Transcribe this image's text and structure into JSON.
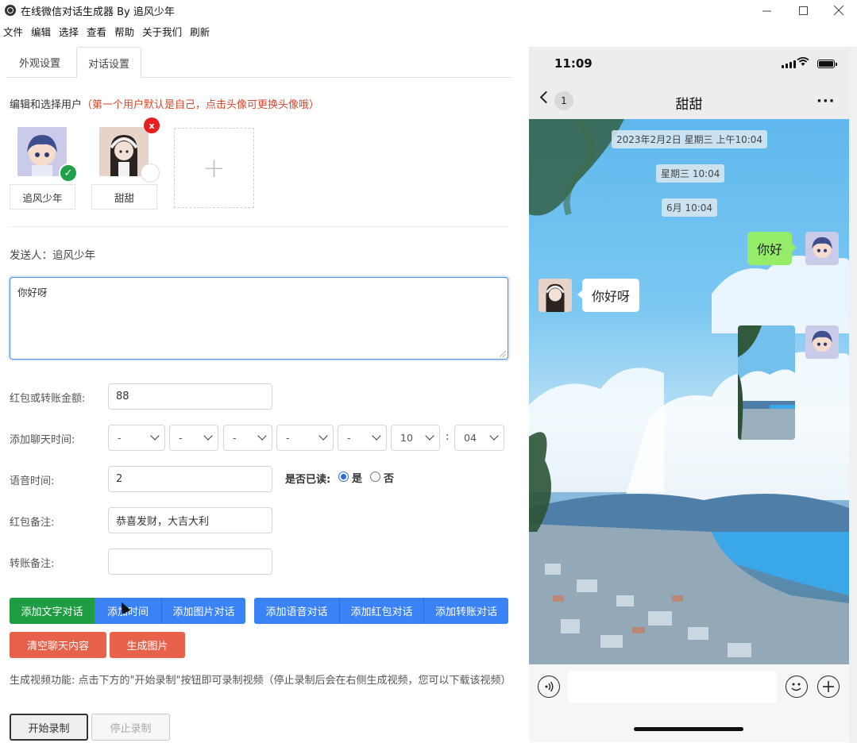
{
  "window": {
    "title": "在线微信对话生成器 By 追风少年",
    "controls": [
      "minimize-icon",
      "maximize-icon",
      "close-icon"
    ]
  },
  "menu": [
    "文件",
    "编辑",
    "选择",
    "查看",
    "帮助",
    "关于我们",
    "刷新"
  ],
  "tabs": [
    {
      "label": "外观设置",
      "active": false
    },
    {
      "label": "对话设置",
      "active": true
    }
  ],
  "users_section": {
    "title": "编辑和选择用户",
    "hint": "（第一个用户默认是自己，点击头像可更换头像哦）",
    "users": [
      {
        "name": "追风少年",
        "selected": true
      },
      {
        "name": "甜甜",
        "selected": false,
        "delete_label": "x"
      }
    ],
    "add_label": "+"
  },
  "sender": "发送人：追风少年",
  "message_text": "你好呀",
  "form": {
    "amount_label": "红包或转账金额:",
    "amount_value": "88",
    "time_label": "添加聊天时间:",
    "time_selects": [
      "-",
      "-",
      "-",
      "-",
      "-",
      "10",
      "04"
    ],
    "time_colon": ":",
    "voice_label": "语音时间:",
    "voice_value": "2",
    "read_label": "是否已读:",
    "read_yes": "是",
    "read_no": "否",
    "read_selected": "是",
    "redpacket_note_label": "红包备注:",
    "redpacket_note_value": "恭喜发财，大吉大利",
    "transfer_note_label": "转账备注:",
    "transfer_note_value": ""
  },
  "buttons": {
    "add_text": "添加文字对话",
    "add_time": "添加时间",
    "add_image": "添加图片对话",
    "add_voice": "添加语音对话",
    "add_redpacket": "添加红包对话",
    "add_transfer": "添加转账对话",
    "clear": "清空聊天内容",
    "generate": "生成图片"
  },
  "video": {
    "description": "生成视频功能: 点击下方的\"开始录制\"按钮即可录制视频（停止录制后会在右侧生成视频，您可以下载该视频）",
    "start_label": "开始录制",
    "stop_label": "停止录制"
  },
  "phone": {
    "status_time": "11:09",
    "nav_count": "1",
    "nav_title": "甜甜",
    "nav_more": "···",
    "timestamps": [
      "2023年2月2日 星期三 上午10:04",
      "星期三 10:04",
      "6月 10:04"
    ],
    "messages": [
      {
        "from": "me",
        "type": "text",
        "text": "你好"
      },
      {
        "from": "other",
        "type": "text",
        "text": "你好呀"
      },
      {
        "from": "me",
        "type": "image"
      }
    ]
  },
  "colors": {
    "primary_blue": "#3b82f6",
    "green": "#1f9d43",
    "red": "#e8614b",
    "hint_red": "#d64a2f",
    "bubble_green": "#95ec69"
  }
}
